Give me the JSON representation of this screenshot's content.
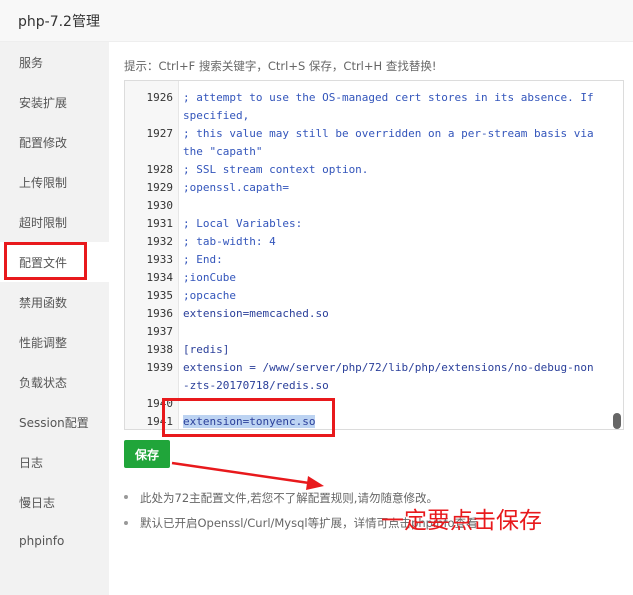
{
  "window": {
    "title": "php-7.2管理"
  },
  "sidebar": {
    "items": [
      {
        "label": "服务"
      },
      {
        "label": "安装扩展"
      },
      {
        "label": "配置修改"
      },
      {
        "label": "上传限制"
      },
      {
        "label": "超时限制"
      },
      {
        "label": "配置文件"
      },
      {
        "label": "禁用函数"
      },
      {
        "label": "性能调整"
      },
      {
        "label": "负载状态"
      },
      {
        "label": "Session配置"
      },
      {
        "label": "日志"
      },
      {
        "label": "慢日志"
      },
      {
        "label": "phpinfo"
      }
    ],
    "active": "配置文件"
  },
  "hint": "提示：Ctrl+F 搜索关键字，Ctrl+S 保存，Ctrl+H 查找替换!",
  "editor": {
    "lines": [
      {
        "num": "1926",
        "text": "; attempt to use the OS-managed cert stores in its absence. If"
      },
      {
        "num": "",
        "text": "  specified,"
      },
      {
        "num": "1927",
        "text": "; this value may still be overridden on a per-stream basis via"
      },
      {
        "num": "",
        "text": "  the \"capath\""
      },
      {
        "num": "1928",
        "text": "; SSL stream context option."
      },
      {
        "num": "1929",
        "text": ";openssl.capath="
      },
      {
        "num": "1930",
        "text": ""
      },
      {
        "num": "1931",
        "text": "; Local Variables:"
      },
      {
        "num": "1932",
        "text": "; tab-width: 4"
      },
      {
        "num": "1933",
        "text": "; End:"
      },
      {
        "num": "1934",
        "text": ";ionCube"
      },
      {
        "num": "1935",
        "text": ";opcache"
      },
      {
        "num": "1936",
        "text": "extension=memcached.so"
      },
      {
        "num": "1937",
        "text": ""
      },
      {
        "num": "1938",
        "text": "[redis]"
      },
      {
        "num": "1939",
        "text": "extension = /www/server/php/72/lib/php/extensions/no-debug-non"
      },
      {
        "num": "",
        "text": "  -zts-20170718/redis.so"
      },
      {
        "num": "1940",
        "text": ""
      },
      {
        "num": "1941",
        "text": "extension=tonyenc.so"
      }
    ]
  },
  "save_button": "保存",
  "notes": [
    "此处为72主配置文件,若您不了解配置规则,请勿随意修改。",
    "默认已开启Openssl/Curl/Mysql等扩展，详情可点击phpinfo查看"
  ],
  "annotation": "一定要点击保存",
  "colors": {
    "accent": "#20a53a",
    "highlight_red": "#e8191c",
    "selection": "#bcd3f2"
  }
}
